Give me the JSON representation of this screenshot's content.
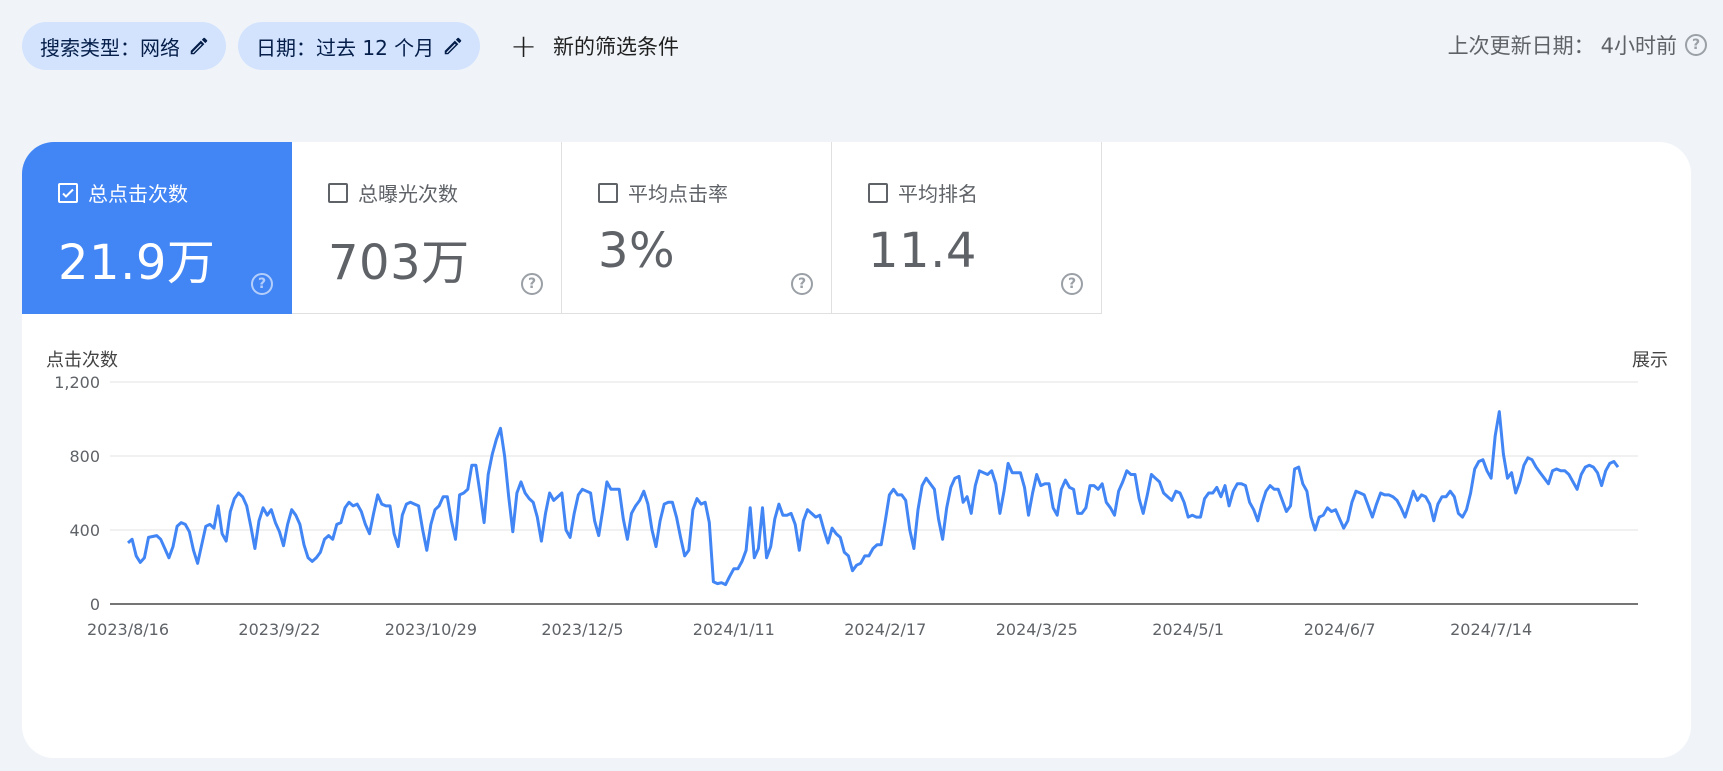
{
  "filters": {
    "search_type": "搜索类型：网络",
    "date": "日期：过去 12 个月",
    "add_label": "新的筛选条件"
  },
  "last_updated": {
    "label": "上次更新日期：",
    "value": "4小时前"
  },
  "metrics": [
    {
      "label": "总点击次数",
      "value": "21.9万",
      "checked": true
    },
    {
      "label": "总曝光次数",
      "value": "703万",
      "checked": false
    },
    {
      "label": "平均点击率",
      "value": "3%",
      "checked": false
    },
    {
      "label": "平均排名",
      "value": "11.4",
      "checked": false
    }
  ],
  "colors": {
    "accent": "#4285f4",
    "line": "#4285f4",
    "chip": "#d3e3fd",
    "background": "#f0f4f9"
  },
  "chart_data": {
    "type": "line",
    "ylabel": "点击次数",
    "y2label": "展示",
    "ylim": [
      0,
      1200
    ],
    "yticks": [
      "0",
      "400",
      "800",
      "1,200"
    ],
    "xticks": [
      "2023/8/16",
      "2023/9/22",
      "2023/10/29",
      "2023/12/5",
      "2024/1/11",
      "2024/2/17",
      "2024/3/25",
      "2024/5/1",
      "2024/6/7",
      "2024/7/14"
    ],
    "grid": true,
    "series": [
      {
        "values": [
          330,
          350,
          260,
          225,
          250,
          360,
          365,
          370,
          350,
          300,
          250,
          310,
          420,
          440,
          430,
          390,
          290,
          220,
          320,
          420,
          430,
          410,
          530,
          380,
          340,
          500,
          570,
          600,
          580,
          530,
          420,
          300,
          450,
          520,
          480,
          510,
          440,
          390,
          315,
          430,
          510,
          480,
          430,
          320,
          250,
          230,
          250,
          280,
          350,
          370,
          350,
          430,
          440,
          520,
          550,
          530,
          540,
          500,
          430,
          380,
          490,
          590,
          540,
          530,
          530,
          380,
          310,
          480,
          540,
          550,
          540,
          530,
          400,
          290,
          430,
          510,
          530,
          580,
          580,
          450,
          350,
          590,
          600,
          620,
          750,
          750,
          600,
          440,
          700,
          810,
          890,
          950,
          800,
          580,
          390,
          600,
          660,
          600,
          570,
          550,
          470,
          340,
          490,
          600,
          560,
          580,
          600,
          400,
          360,
          490,
          590,
          620,
          610,
          600,
          450,
          370,
          510,
          660,
          620,
          620,
          620,
          460,
          350,
          490,
          530,
          560,
          610,
          540,
          400,
          310,
          450,
          540,
          550,
          550,
          470,
          360,
          260,
          290,
          510,
          570,
          540,
          550,
          440,
          120,
          110,
          115,
          105,
          150,
          190,
          190,
          230,
          290,
          520,
          250,
          300,
          520,
          250,
          310,
          460,
          540,
          480,
          480,
          490,
          430,
          290,
          450,
          510,
          490,
          470,
          480,
          400,
          330,
          410,
          380,
          360,
          280,
          260,
          180,
          210,
          220,
          260,
          260,
          300,
          320,
          320,
          450,
          590,
          620,
          590,
          590,
          560,
          400,
          300,
          510,
          640,
          680,
          650,
          620,
          460,
          350,
          520,
          630,
          680,
          690,
          550,
          580,
          490,
          640,
          720,
          710,
          700,
          720,
          650,
          490,
          610,
          760,
          710,
          710,
          710,
          630,
          480,
          600,
          700,
          640,
          650,
          650,
          520,
          480,
          620,
          670,
          630,
          620,
          490,
          490,
          520,
          640,
          640,
          620,
          650,
          550,
          520,
          480,
          610,
          660,
          720,
          700,
          700,
          570,
          490,
          590,
          700,
          680,
          660,
          600,
          580,
          560,
          610,
          600,
          550,
          470,
          480,
          470,
          470,
          570,
          600,
          600,
          630,
          580,
          640,
          530,
          610,
          650,
          650,
          640,
          550,
          510,
          450,
          540,
          610,
          640,
          620,
          620,
          560,
          500,
          530,
          730,
          740,
          650,
          610,
          470,
          400,
          470,
          480,
          520,
          500,
          510,
          460,
          410,
          450,
          550,
          610,
          600,
          590,
          530,
          470,
          540,
          600,
          590,
          590,
          580,
          560,
          520,
          470,
          540,
          610,
          560,
          590,
          580,
          540,
          450,
          540,
          580,
          580,
          610,
          580,
          490,
          470,
          510,
          600,
          730,
          770,
          780,
          720,
          680,
          910,
          1040,
          810,
          680,
          710,
          600,
          660,
          750,
          790,
          780,
          740,
          710,
          680,
          650,
          720,
          730,
          720,
          720,
          700,
          660,
          620,
          700,
          740,
          750,
          740,
          710,
          640,
          720,
          760,
          770,
          740
        ]
      }
    ]
  }
}
